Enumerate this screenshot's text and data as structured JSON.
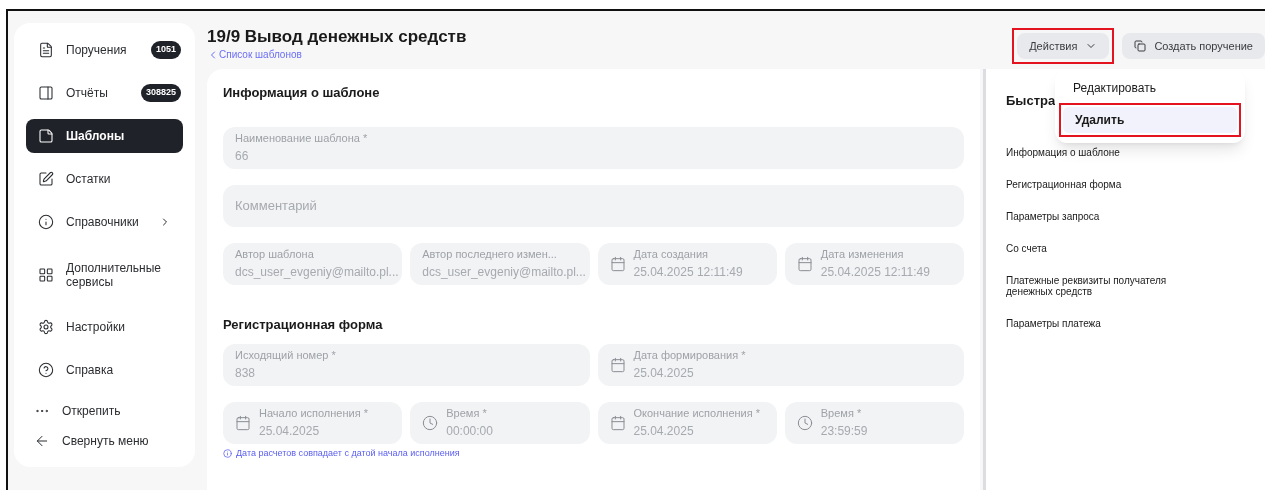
{
  "sidebar": {
    "items": [
      {
        "label": "Поручения",
        "badge": "1051",
        "selected": false,
        "submenu": false
      },
      {
        "label": "Отчёты",
        "badge": "308825",
        "selected": false,
        "submenu": false
      },
      {
        "label": "Шаблоны",
        "selected": true,
        "submenu": false
      },
      {
        "label": "Остатки",
        "selected": false,
        "submenu": false
      },
      {
        "label": "Справочники",
        "selected": false,
        "submenu": true
      },
      {
        "label": "Дополнительные сервисы",
        "selected": false,
        "submenu": false
      },
      {
        "label": "Настройки",
        "selected": false,
        "submenu": false
      },
      {
        "label": "Справка",
        "selected": false,
        "submenu": false
      }
    ],
    "footer": [
      "Открепить",
      "Свернуть меню"
    ]
  },
  "header": {
    "title": "19/9 Вывод денежных средств",
    "breadcrumb": "Список шаблонов"
  },
  "actions": [
    {
      "label": "Действия",
      "kind": "dropdown",
      "highlighted": true
    },
    {
      "label": "Создать поручение",
      "kind": "copy",
      "highlighted": false
    }
  ],
  "menu": [
    {
      "label": "Редактировать",
      "selected": false,
      "highlighted": false
    },
    {
      "label": "Удалить",
      "selected": true,
      "highlighted": true
    }
  ],
  "sections": [
    {
      "title": "Информация о шаблоне",
      "rows": [
        {
          "fields": [
            {
              "kind": "text",
              "label": "Наименование шаблона *",
              "value": "66"
            }
          ]
        },
        {
          "fields": [
            {
              "kind": "text",
              "placeholder": "Комментарий"
            }
          ]
        },
        {
          "fields": [
            {
              "kind": "text",
              "label": "Автор шаблона",
              "value": "dcs_user_evgeniy@mailto.pl..."
            },
            {
              "kind": "text",
              "label": "Автор последнего измен...",
              "value": "dcs_user_evgeniy@mailto.pl..."
            },
            {
              "kind": "date",
              "label": "Дата создания",
              "value": "25.04.2025 12:11:49"
            },
            {
              "kind": "date",
              "label": "Дата изменения",
              "value": "25.04.2025 12:11:49"
            }
          ]
        }
      ]
    },
    {
      "title": "Регистрационная форма",
      "rows": [
        {
          "fields": [
            {
              "kind": "text",
              "label": "Исходящий номер *",
              "value": "838"
            },
            {
              "kind": "date",
              "label": "Дата формирования *",
              "value": "25.04.2025"
            }
          ]
        },
        {
          "fields": [
            {
              "kind": "date",
              "label": "Начало исполнения *",
              "value": "25.04.2025"
            },
            {
              "kind": "time",
              "label": "Время *",
              "value": "00:00:00"
            },
            {
              "kind": "date",
              "label": "Окончание исполнения *",
              "value": "25.04.2025"
            },
            {
              "kind": "time",
              "label": "Время *",
              "value": "23:59:59"
            }
          ]
        }
      ],
      "note": "Дата расчетов совпадает с датой начала исполнения"
    }
  ],
  "quick_nav": {
    "title": "Быстра",
    "links": [
      "Информация о шаблоне",
      "Регистрационная форма",
      "Параметры запроса",
      "Со счета",
      "Платежные реквизиты получателя денежных средств",
      "Параметры платежа"
    ]
  }
}
